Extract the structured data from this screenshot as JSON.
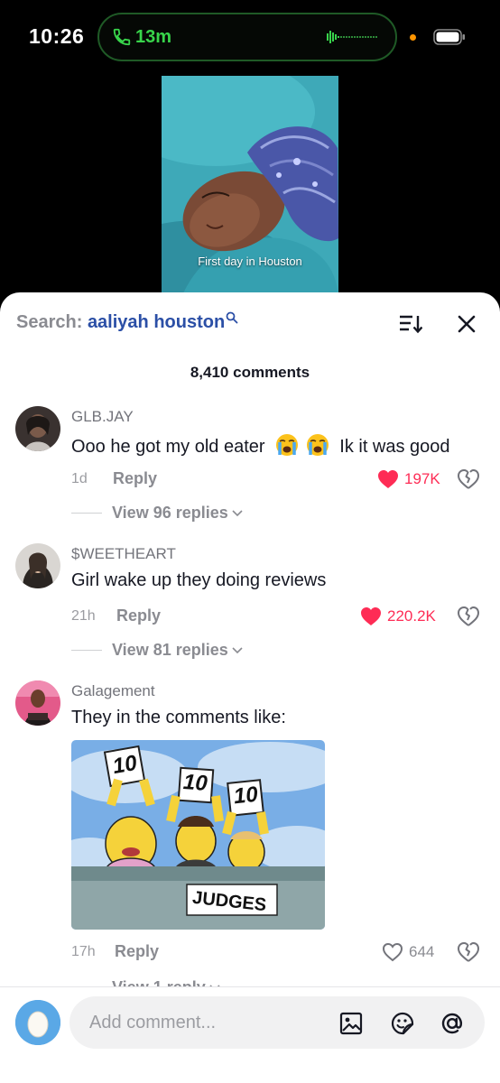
{
  "status": {
    "time": "10:26",
    "call_timer": "13m"
  },
  "video": {
    "caption": "First day in Houston"
  },
  "search": {
    "label": "Search:",
    "query": "aaliyah houston"
  },
  "comment_count": "8,410 comments",
  "comments": [
    {
      "username": "GLB.JAY",
      "text_a": "Ooo he got my old eater",
      "text_b": "Ik it was good",
      "time": "1d",
      "reply": "Reply",
      "likes": "197K",
      "liked": true,
      "view_replies": "View 96 replies"
    },
    {
      "username": "$WEETHEART",
      "text": "Girl wake up they doing reviews",
      "time": "21h",
      "reply": "Reply",
      "likes": "220.2K",
      "liked": true,
      "view_replies": "View 81 replies"
    },
    {
      "username": "Galagement",
      "text": "They in the comments like:",
      "time": "17h",
      "reply": "Reply",
      "likes": "644",
      "liked": false,
      "view_replies": "View 1 reply",
      "gif": {
        "cards": [
          "10",
          "10",
          "10"
        ],
        "sign": "JUDGES"
      }
    }
  ],
  "composer": {
    "placeholder": "Add comment..."
  },
  "colors": {
    "like_red": "#fe2c55",
    "query_blue": "#2b4fa6",
    "call_green": "#38d44b"
  }
}
